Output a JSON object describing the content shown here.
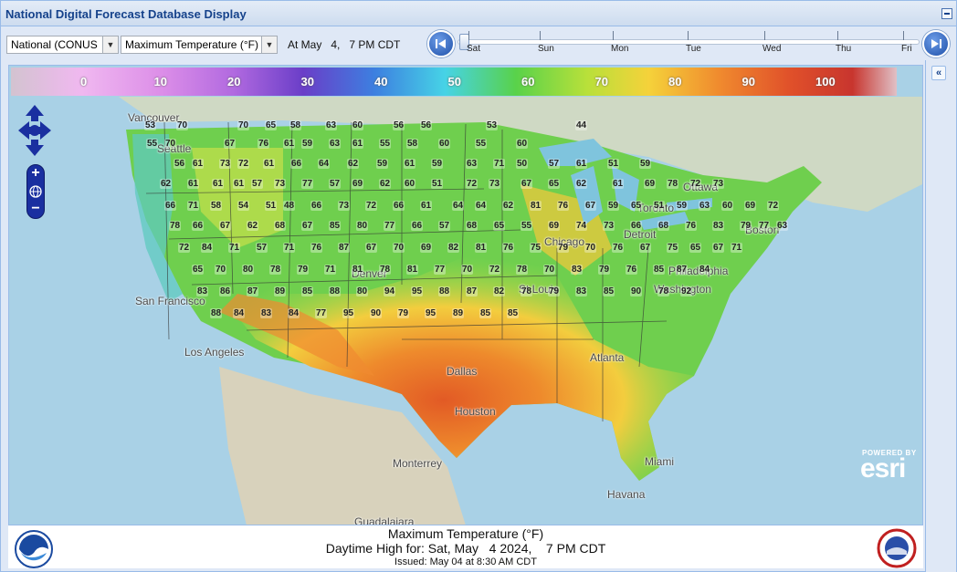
{
  "window": {
    "title": "National Digital Forecast Database Display"
  },
  "toolbar": {
    "region_select": "National (CONUS",
    "element_select": "Maximum Temperature (°F)",
    "valid_time": "At May   4,   7 PM CDT",
    "timeline_days": [
      "Sat",
      "Sun",
      "Mon",
      "Tue",
      "Wed",
      "Thu",
      "Fri"
    ]
  },
  "legend": {
    "values": [
      "0",
      "10",
      "20",
      "30",
      "40",
      "50",
      "60",
      "70",
      "80",
      "90",
      "100"
    ]
  },
  "map": {
    "cities": [
      "Vancouver",
      "Seattle",
      "Ottawa",
      "Toronto",
      "Chicago",
      "Detroit",
      "Denver",
      "San Francisco",
      "St Louis",
      "Philadelphia",
      "Washington",
      "Boston",
      "Los Angeles",
      "Dallas",
      "Houston",
      "Atlanta",
      "Miami",
      "Havana",
      "Monterrey",
      "Guadalajara"
    ],
    "temperature_markers": [
      "53",
      "70",
      "70",
      "65",
      "58",
      "63",
      "60",
      "56",
      "56",
      "53",
      "44",
      "55",
      "70",
      "67",
      "76",
      "61",
      "59",
      "63",
      "61",
      "55",
      "58",
      "60",
      "55",
      "60",
      "56",
      "61",
      "73",
      "72",
      "61",
      "66",
      "64",
      "62",
      "59",
      "61",
      "59",
      "63",
      "71",
      "50",
      "57",
      "61",
      "51",
      "59",
      "62",
      "61",
      "61",
      "61",
      "57",
      "73",
      "77",
      "57",
      "69",
      "62",
      "60",
      "51",
      "72",
      "73",
      "67",
      "65",
      "62",
      "61",
      "69",
      "78",
      "72",
      "73",
      "66",
      "71",
      "58",
      "54",
      "51",
      "48",
      "66",
      "73",
      "72",
      "66",
      "61",
      "64",
      "64",
      "62",
      "81",
      "76",
      "67",
      "59",
      "65",
      "51",
      "59",
      "63",
      "60",
      "69",
      "72",
      "78",
      "66",
      "67",
      "62",
      "68",
      "67",
      "85",
      "80",
      "77",
      "66",
      "57",
      "68",
      "65",
      "55",
      "69",
      "74",
      "73",
      "66",
      "68",
      "76",
      "83",
      "79",
      "77",
      "63",
      "72",
      "84",
      "71",
      "57",
      "71",
      "76",
      "87",
      "67",
      "70",
      "69",
      "82",
      "81",
      "76",
      "75",
      "79",
      "70",
      "76",
      "67",
      "75",
      "65",
      "67",
      "71",
      "65",
      "70",
      "80",
      "78",
      "79",
      "71",
      "81",
      "78",
      "81",
      "77",
      "70",
      "72",
      "78",
      "70",
      "83",
      "79",
      "76",
      "85",
      "87",
      "84",
      "83",
      "86",
      "87",
      "89",
      "85",
      "88",
      "80",
      "94",
      "95",
      "88",
      "87",
      "82",
      "78",
      "79",
      "83",
      "85",
      "90",
      "78",
      "92",
      "88",
      "84",
      "83",
      "84",
      "77",
      "95",
      "90",
      "79",
      "95",
      "89",
      "85",
      "85"
    ]
  },
  "branding": {
    "esri_powered": "POWERED BY",
    "esri_name": "esri"
  },
  "footer": {
    "line1": "Maximum Temperature (°F)",
    "line2": "Daytime High for: Sat, May   4 2024,    7 PM CDT",
    "line3": "Issued: May 04 at 8:30 AM CDT"
  },
  "colors": {
    "panel": "#dfe8f6",
    "title": "#15428b",
    "water": "#a3cde3",
    "border": "#99bbe8"
  }
}
